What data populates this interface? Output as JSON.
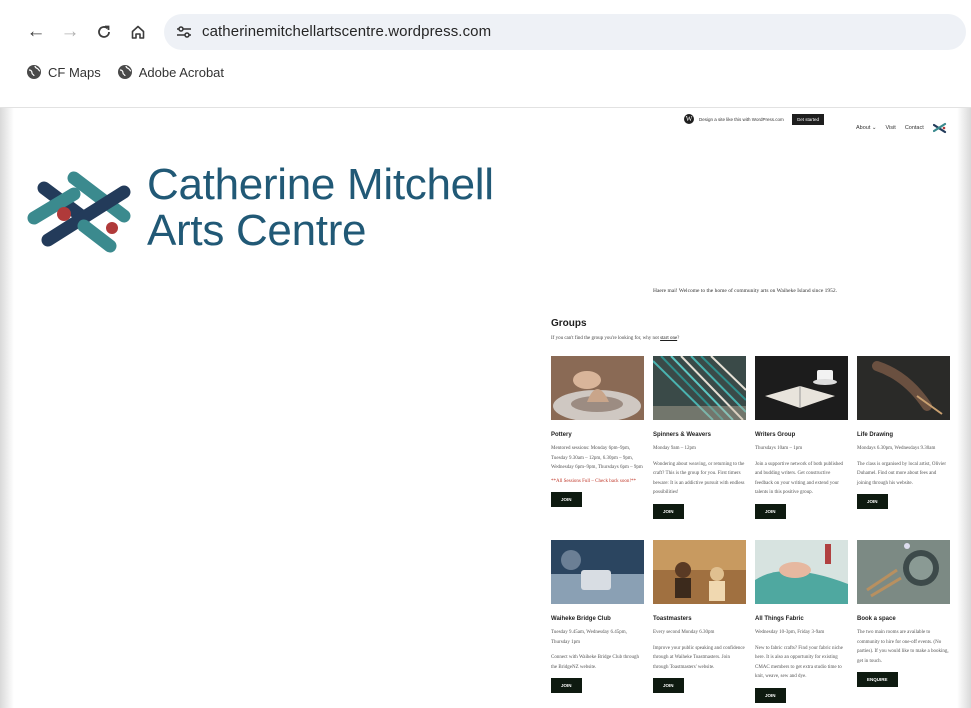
{
  "browser": {
    "url": "catherinemitchellartscentre.wordpress.com",
    "bookmarks": [
      {
        "label": "CF Maps",
        "icon": "globe-icon"
      },
      {
        "label": "Adobe Acrobat",
        "icon": "globe-icon"
      }
    ]
  },
  "wp_bar": {
    "text": "Design a site like this with WordPress.com",
    "button": "Get started"
  },
  "nav": {
    "items": [
      "About ⌄",
      "Visit",
      "Contact"
    ]
  },
  "site": {
    "title_line1": "Catherine Mitchell",
    "title_line2": "Arts Centre",
    "welcome": "Haere mai! Welcome to the home of community arts on Waiheke Island since 1952."
  },
  "groups": {
    "heading": "Groups",
    "subtitle_pre": "If you can't find the group you're looking for, why not ",
    "subtitle_link": "start one",
    "subtitle_post": "?",
    "cards": [
      {
        "title": "Pottery",
        "desc": "Mentored sessions: Monday 6pm–9pm, Tuesday 9.30am – 12pm, 6.30pm – 9pm, Wednesday 6pm–9pm, Thursdays 6pm – 9pm",
        "note": "**All Sessions Full – Check back soon!**",
        "button": "JOIN",
        "image": "pottery-wheel-photo"
      },
      {
        "title": "Spinners & Weavers",
        "desc": "Monday 9am – 12pm",
        "desc2": "Wondering about weaving, or returning to the craft? This is the group for you. First timers beware: It is an addictive pursuit with endless possibilities!",
        "button": "JOIN",
        "image": "loom-threads-photo"
      },
      {
        "title": "Writers Group",
        "desc": "Thursdays 10am – 1pm",
        "desc2": "Join a supportive network of both published and budding writers. Get constructive feedback on your writing and extend your talents in this positive group.",
        "button": "JOIN",
        "image": "book-and-cup-photo"
      },
      {
        "title": "Life Drawing",
        "desc": "Mondays 6.30pm, Wednesdays 9.30am",
        "desc2": "The class is organised by local artist, Olivier Duhamel. Find out more about fees and joining through his website.",
        "button": "JOIN",
        "image": "drawing-hand-photo"
      },
      {
        "title": "Waiheke Bridge Club",
        "desc": "Tuesday 9.45am, Wednesday 6.45pm, Thursday 1pm",
        "desc2": "Connect with Waiheke Bridge Club through the BridgeNZ website.",
        "button": "JOIN",
        "image": "bridge-players-photo"
      },
      {
        "title": "Toastmasters",
        "desc": "Every second Monday 6.30pm",
        "desc2": "Improve your public speaking and confidence through at Waiheke Toastmasters. Join through Toastmasters' website.",
        "button": "JOIN",
        "image": "meeting-room-photo"
      },
      {
        "title": "All Things Fabric",
        "desc": "Wednesday 10-3pm, Friday 3-9am",
        "desc2": "New to fabric crafts? Find your fabric niche here. It is also an opportunity for existing CMAC members to get extra studio time to knit, weave, sew and dye.",
        "button": "JOIN",
        "image": "sewing-fabric-photo"
      },
      {
        "title": "Book a space",
        "desc": "The two main rooms are available to community to hire for one-off events. (No parties). If you would like to make a booking, get in touch.",
        "button": "ENQUIRE",
        "image": "craft-tools-photo"
      }
    ]
  },
  "colors": {
    "title": "#215976",
    "logo_navy": "#233b5a",
    "logo_teal": "#3b8a8e",
    "logo_red": "#b03a3a",
    "button_bg": "#0e1a10"
  }
}
